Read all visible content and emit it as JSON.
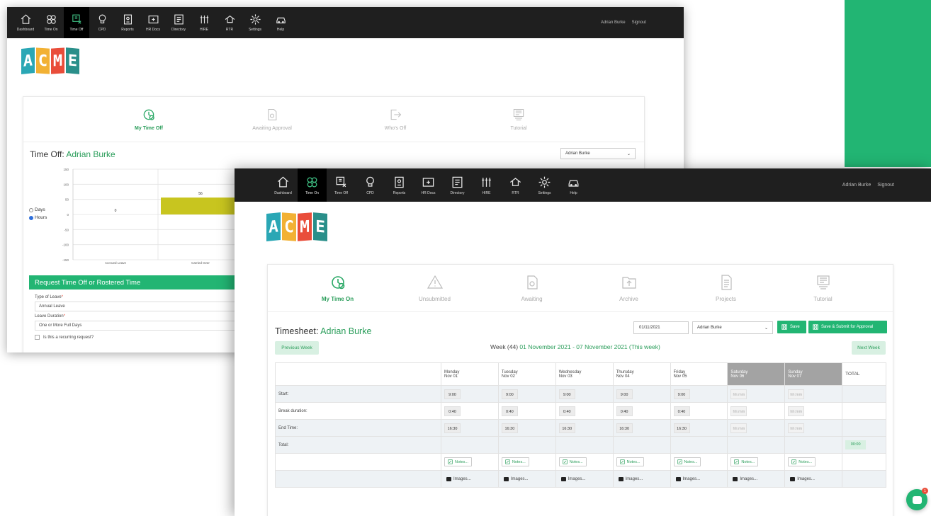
{
  "nav_back": {
    "items": [
      "Dashboard",
      "Time On",
      "Time Off",
      "CPD",
      "Reports",
      "HR Docs",
      "Directory",
      "HIRE",
      "RTR",
      "Settings",
      "Help"
    ],
    "active": "Time Off",
    "user_name": "Adrian Burke",
    "signout": "Signout"
  },
  "nav_front": {
    "items": [
      "Dashboard",
      "Time On",
      "Time Off",
      "CPD",
      "Reports",
      "HR Docs",
      "Directory",
      "HIRE",
      "RTR",
      "Settings",
      "Help"
    ],
    "active": "Time On",
    "user_name": "Adrian Burke",
    "signout": "Signout"
  },
  "logo": [
    "A",
    "C",
    "M",
    "E"
  ],
  "back_tabs": [
    "My Time Off",
    "Awaiting Approval",
    "Who's Off",
    "Tutorial"
  ],
  "front_tabs": [
    "My Time On",
    "Unsubmitted",
    "Awaiting",
    "Archive",
    "Projects",
    "Tutorial"
  ],
  "time_off": {
    "title_prefix": "Time Off: ",
    "title_name": "Adrian Burke",
    "employee_select": "Adrian Burke",
    "unit_options": [
      "Days",
      "Hours"
    ],
    "selected_unit": "Hours"
  },
  "chart_data": {
    "type": "bar",
    "categories": [
      "Accrued Leave",
      "Carried Over"
    ],
    "values": [
      0,
      56
    ],
    "ylim": [
      -150,
      150
    ],
    "yticks": [
      150,
      100,
      50,
      0,
      -50,
      -100,
      -150
    ],
    "grid": true,
    "colors": {
      "bar": "#c8c51f"
    }
  },
  "request": {
    "header": "Request Time Off or Rostered Time",
    "type_label": "Type of Leave",
    "type_value": "Annual Leave",
    "duration_label": "Leave Duration",
    "duration_value": "One or More Full Days",
    "recurring_label": "Is this a recurring request?"
  },
  "timesheet": {
    "title_prefix": "Timesheet: ",
    "title_name": "Adrian Burke",
    "date_value": "01/11/2021",
    "employee_select": "Adrian Burke",
    "save_label": "Save",
    "submit_label": "Save & Submit for Approval",
    "prev_week": "Previous Week",
    "next_week": "Next Week",
    "week_prefix": "Week (44) ",
    "week_range": "01 November 2021 - 07 November 2021 (This week)",
    "days": [
      {
        "name": "Monday",
        "date": "Nov 01",
        "weekend": false
      },
      {
        "name": "Tuesday",
        "date": "Nov 02",
        "weekend": false
      },
      {
        "name": "Wednesday",
        "date": "Nov 03",
        "weekend": false
      },
      {
        "name": "Thursday",
        "date": "Nov 04",
        "weekend": false
      },
      {
        "name": "Friday",
        "date": "Nov 05",
        "weekend": false
      },
      {
        "name": "Saturday",
        "date": "Nov 06",
        "weekend": true
      },
      {
        "name": "Sunday",
        "date": "Nov 07",
        "weekend": true
      }
    ],
    "total_header": "TOTAL",
    "rows": [
      {
        "label": "Start:",
        "values": [
          "9:00",
          "9:00",
          "9:00",
          "9:00",
          "9:00",
          "hh:mm",
          "hh:mm"
        ]
      },
      {
        "label": "Break duration:",
        "values": [
          "0:40",
          "0:40",
          "0:40",
          "0:40",
          "0:40",
          "hh:mm",
          "hh:mm"
        ]
      },
      {
        "label": "End Time:",
        "values": [
          "16:30",
          "16:30",
          "16:30",
          "16:30",
          "16:30",
          "hh:mm",
          "hh:mm"
        ]
      }
    ],
    "total_label": "Total:",
    "total_value": "00:00",
    "notes_label": "Notes...",
    "images_label": "Images..."
  },
  "chat_badge": "1",
  "colors": {
    "brand_green": "#22b573",
    "nav_bg": "#1f1f1f",
    "weekend_header": "#a3a3a3"
  }
}
